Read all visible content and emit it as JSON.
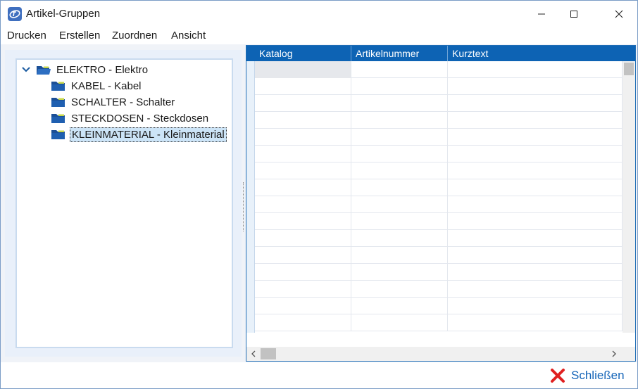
{
  "window": {
    "title": "Artikel-Gruppen",
    "icons": {
      "app": "app-logo-icon",
      "minimize": "minimize-icon",
      "maximize": "maximize-icon",
      "close": "close-window-icon"
    }
  },
  "menu": {
    "items": [
      {
        "label": "Drucken"
      },
      {
        "label": "Erstellen"
      },
      {
        "label": "Zuordnen"
      },
      {
        "label": "Ansicht"
      }
    ]
  },
  "tree": {
    "root": {
      "label": "ELEKTRO - Elektro",
      "expanded": true,
      "icon": "folder-open-icon"
    },
    "children": [
      {
        "label": "KABEL - Kabel",
        "icon": "folder-icon",
        "selected": false
      },
      {
        "label": "SCHALTER - Schalter",
        "icon": "folder-icon",
        "selected": false
      },
      {
        "label": "STECKDOSEN - Steckdosen",
        "icon": "folder-icon",
        "selected": false
      },
      {
        "label": "KLEINMATERIAL - Kleinmaterial",
        "icon": "folder-icon",
        "selected": true
      }
    ]
  },
  "grid": {
    "columns": [
      {
        "label": "Katalog"
      },
      {
        "label": "Artikelnummer"
      },
      {
        "label": "Kurztext"
      }
    ],
    "rows": []
  },
  "footer": {
    "close_label": "Schließen",
    "close_icon": "red-x-icon"
  },
  "colors": {
    "accent": "#0d63b4",
    "selection": "#cce4f7",
    "close_icon": "#e02020",
    "close_text": "#1565b8"
  }
}
